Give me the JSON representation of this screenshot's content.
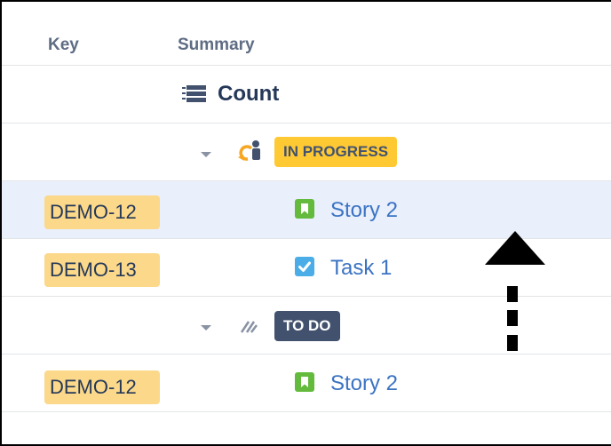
{
  "columns": {
    "key": "Key",
    "summary": "Summary"
  },
  "count_row": {
    "icon": "list-count-icon",
    "label": "Count"
  },
  "groups": [
    {
      "status": "IN PROGRESS",
      "status_icon": "in-progress-status-icon",
      "status_color": "#ffc933",
      "rows": [
        {
          "key": "DEMO-12",
          "type": "story",
          "type_icon": "story-icon",
          "summary": "Story 2",
          "highlighted": true
        },
        {
          "key": "DEMO-13",
          "type": "task",
          "type_icon": "task-checkbox-icon",
          "summary": "Task 1",
          "highlighted": false
        }
      ]
    },
    {
      "status": "TO DO",
      "status_icon": "to-do-status-icon",
      "status_color": "#42526e",
      "rows": [
        {
          "key": "DEMO-12",
          "type": "story",
          "type_icon": "story-icon",
          "summary": "Story 2",
          "highlighted": false
        }
      ]
    }
  ],
  "annotation": {
    "icon": "drag-up-arrow-icon",
    "color": "#000000"
  }
}
